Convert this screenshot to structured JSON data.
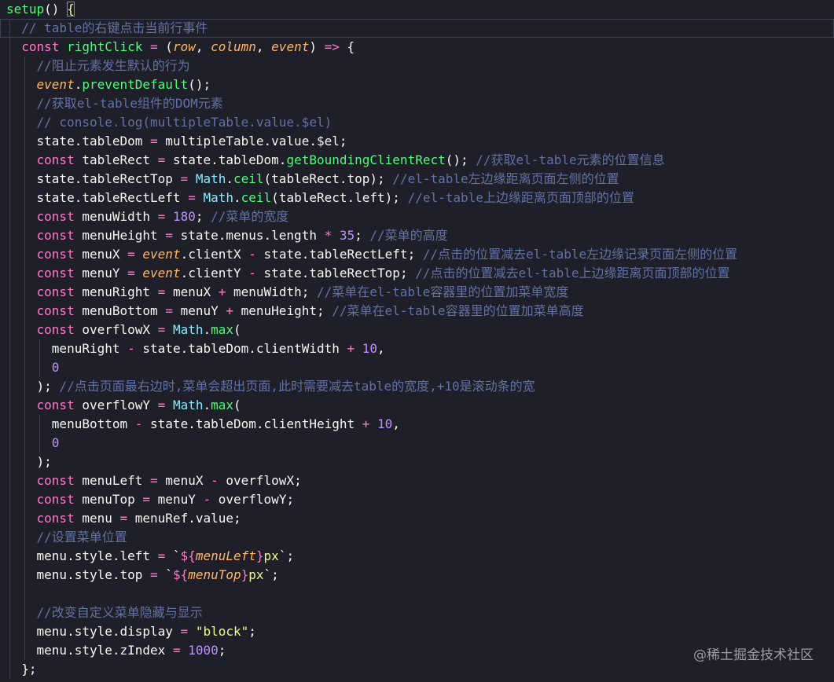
{
  "watermark": "@稀土掘金技术社区",
  "theme": {
    "background": "#1e1f29",
    "keyword": "#ff79c6",
    "function": "#50fa7b",
    "parameter": "#ffb86c",
    "number": "#bd93f9",
    "string": "#f1fa8c",
    "comment": "#6272a4",
    "builtin": "#8be9fd"
  },
  "lines": [
    {
      "indent": 0,
      "tokens": [
        [
          "fn",
          "setup"
        ],
        [
          "punct",
          "() "
        ],
        [
          "bracket",
          "{"
        ]
      ]
    },
    {
      "indent": 1,
      "current": true,
      "tokens": [
        [
          "comment",
          "// table的右键点击当前行事件"
        ]
      ]
    },
    {
      "indent": 1,
      "tokens": [
        [
          "kw",
          "const "
        ],
        [
          "fn",
          "rightClick"
        ],
        [
          "op",
          " = "
        ],
        [
          "punct",
          "("
        ],
        [
          "param",
          "row"
        ],
        [
          "punct",
          ", "
        ],
        [
          "param",
          "column"
        ],
        [
          "punct",
          ", "
        ],
        [
          "param",
          "event"
        ],
        [
          "punct",
          ") "
        ],
        [
          "op",
          "=>"
        ],
        [
          "punct",
          " {"
        ]
      ]
    },
    {
      "indent": 2,
      "tokens": [
        [
          "comment",
          "//阻止元素发生默认的行为"
        ]
      ]
    },
    {
      "indent": 2,
      "tokens": [
        [
          "italic",
          "event"
        ],
        [
          "punct",
          "."
        ],
        [
          "method",
          "preventDefault"
        ],
        [
          "punct",
          "();"
        ]
      ]
    },
    {
      "indent": 2,
      "tokens": [
        [
          "comment",
          "//获取el-table组件的DOM元素"
        ]
      ]
    },
    {
      "indent": 2,
      "tokens": [
        [
          "comment",
          "// console.log(multipleTable.value.$el)"
        ]
      ]
    },
    {
      "indent": 2,
      "tokens": [
        [
          "id",
          "state.tableDom"
        ],
        [
          "op",
          " = "
        ],
        [
          "id",
          "multipleTable.value.$el;"
        ]
      ]
    },
    {
      "indent": 2,
      "tokens": [
        [
          "kw",
          "const "
        ],
        [
          "id",
          "tableRect"
        ],
        [
          "op",
          " = "
        ],
        [
          "id",
          "state.tableDom."
        ],
        [
          "method",
          "getBoundingClientRect"
        ],
        [
          "punct",
          "(); "
        ],
        [
          "comment",
          "//获取el-table元素的位置信息"
        ]
      ]
    },
    {
      "indent": 2,
      "tokens": [
        [
          "id",
          "state.tableRectTop"
        ],
        [
          "op",
          " = "
        ],
        [
          "class",
          "Math"
        ],
        [
          "punct",
          "."
        ],
        [
          "method",
          "ceil"
        ],
        [
          "punct",
          "("
        ],
        [
          "id",
          "tableRect.top"
        ],
        [
          "punct",
          "); "
        ],
        [
          "comment",
          "//el-table左边缘距离页面左侧的位置"
        ]
      ]
    },
    {
      "indent": 2,
      "tokens": [
        [
          "id",
          "state.tableRectLeft"
        ],
        [
          "op",
          " = "
        ],
        [
          "class",
          "Math"
        ],
        [
          "punct",
          "."
        ],
        [
          "method",
          "ceil"
        ],
        [
          "punct",
          "("
        ],
        [
          "id",
          "tableRect.left"
        ],
        [
          "punct",
          "); "
        ],
        [
          "comment",
          "//el-table上边缘距离页面顶部的位置"
        ]
      ]
    },
    {
      "indent": 2,
      "tokens": [
        [
          "kw",
          "const "
        ],
        [
          "id",
          "menuWidth"
        ],
        [
          "op",
          " = "
        ],
        [
          "num",
          "180"
        ],
        [
          "punct",
          "; "
        ],
        [
          "comment",
          "//菜单的宽度"
        ]
      ]
    },
    {
      "indent": 2,
      "tokens": [
        [
          "kw",
          "const "
        ],
        [
          "id",
          "menuHeight"
        ],
        [
          "op",
          " = "
        ],
        [
          "id",
          "state.menus.length"
        ],
        [
          "op",
          " * "
        ],
        [
          "num",
          "35"
        ],
        [
          "punct",
          "; "
        ],
        [
          "comment",
          "//菜单的高度"
        ]
      ]
    },
    {
      "indent": 2,
      "tokens": [
        [
          "kw",
          "const "
        ],
        [
          "id",
          "menuX"
        ],
        [
          "op",
          " = "
        ],
        [
          "italic",
          "event"
        ],
        [
          "id",
          ".clientX"
        ],
        [
          "op",
          " - "
        ],
        [
          "id",
          "state.tableRectLeft"
        ],
        [
          "punct",
          "; "
        ],
        [
          "comment",
          "//点击的位置减去el-table左边缘记录页面左侧的位置"
        ]
      ]
    },
    {
      "indent": 2,
      "tokens": [
        [
          "kw",
          "const "
        ],
        [
          "id",
          "menuY"
        ],
        [
          "op",
          " = "
        ],
        [
          "italic",
          "event"
        ],
        [
          "id",
          ".clientY"
        ],
        [
          "op",
          " - "
        ],
        [
          "id",
          "state.tableRectTop"
        ],
        [
          "punct",
          "; "
        ],
        [
          "comment",
          "//点击的位置减去el-table上边缘距离页面顶部的位置"
        ]
      ]
    },
    {
      "indent": 2,
      "tokens": [
        [
          "kw",
          "const "
        ],
        [
          "id",
          "menuRight"
        ],
        [
          "op",
          " = "
        ],
        [
          "id",
          "menuX"
        ],
        [
          "op",
          " + "
        ],
        [
          "id",
          "menuWidth"
        ],
        [
          "punct",
          "; "
        ],
        [
          "comment",
          "//菜单在el-table容器里的位置加菜单宽度"
        ]
      ]
    },
    {
      "indent": 2,
      "tokens": [
        [
          "kw",
          "const "
        ],
        [
          "id",
          "menuBottom"
        ],
        [
          "op",
          " = "
        ],
        [
          "id",
          "menuY"
        ],
        [
          "op",
          " + "
        ],
        [
          "id",
          "menuHeight"
        ],
        [
          "punct",
          "; "
        ],
        [
          "comment",
          "//菜单在el-table容器里的位置加菜单高度"
        ]
      ]
    },
    {
      "indent": 2,
      "tokens": [
        [
          "kw",
          "const "
        ],
        [
          "id",
          "overflowX"
        ],
        [
          "op",
          " = "
        ],
        [
          "class",
          "Math"
        ],
        [
          "punct",
          "."
        ],
        [
          "method",
          "max"
        ],
        [
          "punct",
          "("
        ]
      ]
    },
    {
      "indent": 3,
      "tokens": [
        [
          "id",
          "menuRight"
        ],
        [
          "op",
          " - "
        ],
        [
          "id",
          "state.tableDom.clientWidth"
        ],
        [
          "op",
          " + "
        ],
        [
          "num",
          "10"
        ],
        [
          "punct",
          ","
        ]
      ]
    },
    {
      "indent": 3,
      "tokens": [
        [
          "num",
          "0"
        ]
      ]
    },
    {
      "indent": 2,
      "tokens": [
        [
          "punct",
          "); "
        ],
        [
          "comment",
          "//点击页面最右边时,菜单会超出页面,此时需要减去table的宽度,+10是滚动条的宽"
        ]
      ]
    },
    {
      "indent": 2,
      "tokens": [
        [
          "kw",
          "const "
        ],
        [
          "id",
          "overflowY"
        ],
        [
          "op",
          " = "
        ],
        [
          "class",
          "Math"
        ],
        [
          "punct",
          "."
        ],
        [
          "method",
          "max"
        ],
        [
          "punct",
          "("
        ]
      ]
    },
    {
      "indent": 3,
      "tokens": [
        [
          "id",
          "menuBottom"
        ],
        [
          "op",
          " - "
        ],
        [
          "id",
          "state.tableDom.clientHeight"
        ],
        [
          "op",
          " + "
        ],
        [
          "num",
          "10"
        ],
        [
          "punct",
          ","
        ]
      ]
    },
    {
      "indent": 3,
      "tokens": [
        [
          "num",
          "0"
        ]
      ]
    },
    {
      "indent": 2,
      "tokens": [
        [
          "punct",
          ");"
        ]
      ]
    },
    {
      "indent": 2,
      "tokens": [
        [
          "kw",
          "const "
        ],
        [
          "id",
          "menuLeft"
        ],
        [
          "op",
          " = "
        ],
        [
          "id",
          "menuX"
        ],
        [
          "op",
          " - "
        ],
        [
          "id",
          "overflowX"
        ],
        [
          "punct",
          ";"
        ]
      ]
    },
    {
      "indent": 2,
      "tokens": [
        [
          "kw",
          "const "
        ],
        [
          "id",
          "menuTop"
        ],
        [
          "op",
          " = "
        ],
        [
          "id",
          "menuY"
        ],
        [
          "op",
          " - "
        ],
        [
          "id",
          "overflowY"
        ],
        [
          "punct",
          ";"
        ]
      ]
    },
    {
      "indent": 2,
      "tokens": [
        [
          "kw",
          "const "
        ],
        [
          "id",
          "menu"
        ],
        [
          "op",
          " = "
        ],
        [
          "id",
          "menuRef.value"
        ],
        [
          "punct",
          ";"
        ]
      ]
    },
    {
      "indent": 2,
      "tokens": [
        [
          "comment",
          "//设置菜单位置"
        ]
      ]
    },
    {
      "indent": 2,
      "tokens": [
        [
          "id",
          "menu.style.left"
        ],
        [
          "op",
          " = "
        ],
        [
          "punct",
          "`"
        ],
        [
          "tpl",
          "${"
        ],
        [
          "italic",
          "menuLeft"
        ],
        [
          "tpl",
          "}"
        ],
        [
          "str",
          "px"
        ],
        [
          "punct",
          "`;"
        ]
      ]
    },
    {
      "indent": 2,
      "tokens": [
        [
          "id",
          "menu.style.top"
        ],
        [
          "op",
          " = "
        ],
        [
          "punct",
          "`"
        ],
        [
          "tpl",
          "${"
        ],
        [
          "italic",
          "menuTop"
        ],
        [
          "tpl",
          "}"
        ],
        [
          "str",
          "px"
        ],
        [
          "punct",
          "`;"
        ]
      ]
    },
    {
      "indent": 2,
      "tokens": []
    },
    {
      "indent": 2,
      "tokens": [
        [
          "comment",
          "//改变自定义菜单隐藏与显示"
        ]
      ]
    },
    {
      "indent": 2,
      "tokens": [
        [
          "id",
          "menu.style.display"
        ],
        [
          "op",
          " = "
        ],
        [
          "str",
          "\"block\""
        ],
        [
          "punct",
          ";"
        ]
      ]
    },
    {
      "indent": 2,
      "tokens": [
        [
          "id",
          "menu.style.zIndex"
        ],
        [
          "op",
          " = "
        ],
        [
          "num",
          "1000"
        ],
        [
          "punct",
          ";"
        ]
      ]
    },
    {
      "indent": 1,
      "tokens": [
        [
          "punct",
          "};"
        ]
      ]
    }
  ]
}
